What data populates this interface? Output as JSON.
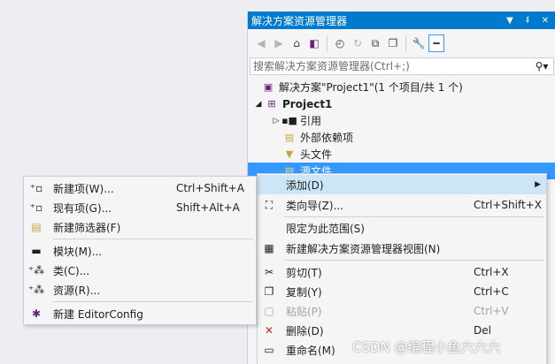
{
  "panel": {
    "title": "解决方案资源管理器",
    "title_buttons": [
      "▾",
      "📌",
      "✕"
    ]
  },
  "toolbar": {
    "icons": [
      "back-icon",
      "forward-icon",
      "home-icon",
      "vs-switch-icon",
      "history-icon",
      "refresh-icon",
      "collapse-all-icon",
      "copy-icon",
      "properties-wrench-icon",
      "preview-pin-icon"
    ]
  },
  "search": {
    "placeholder": "搜索解决方案资源管理器(Ctrl+;)"
  },
  "tree": {
    "solution": "解决方案\"Project1\"(1 个项目/共 1 个)",
    "project": "Project1",
    "references": "引用",
    "external_deps": "外部依赖项",
    "header_files": "头文件",
    "source_files": "源文件"
  },
  "main_menu": {
    "add": "添加(D)",
    "class_wizard": "类向导(Z)...",
    "class_wizard_shortcut": "Ctrl+Shift+X",
    "scope": "限定为此范围(S)",
    "new_view": "新建解决方案资源管理器视图(N)",
    "cut": "剪切(T)",
    "cut_shortcut": "Ctrl+X",
    "copy": "复制(Y)",
    "copy_shortcut": "Ctrl+C",
    "paste": "粘贴(P)",
    "paste_shortcut": "Ctrl+V",
    "delete": "删除(D)",
    "delete_shortcut": "Del",
    "rename": "重命名(M)"
  },
  "sub_menu": {
    "new_item": "新建项(W)...",
    "new_item_shortcut": "Ctrl+Shift+A",
    "existing_item": "现有项(G)...",
    "existing_item_shortcut": "Shift+Alt+A",
    "new_filter": "新建筛选器(F)",
    "module": "模块(M)...",
    "class": "类(C)...",
    "resource": "资源(R)...",
    "editorconfig": "新建 EditorConfig"
  },
  "watermark": "CSDN @编程小鱼六六六",
  "colors": {
    "accent": "#007acc",
    "selection": "#3399ff",
    "menu_bg": "#f5f5f5",
    "hover": "#cde6f7"
  }
}
